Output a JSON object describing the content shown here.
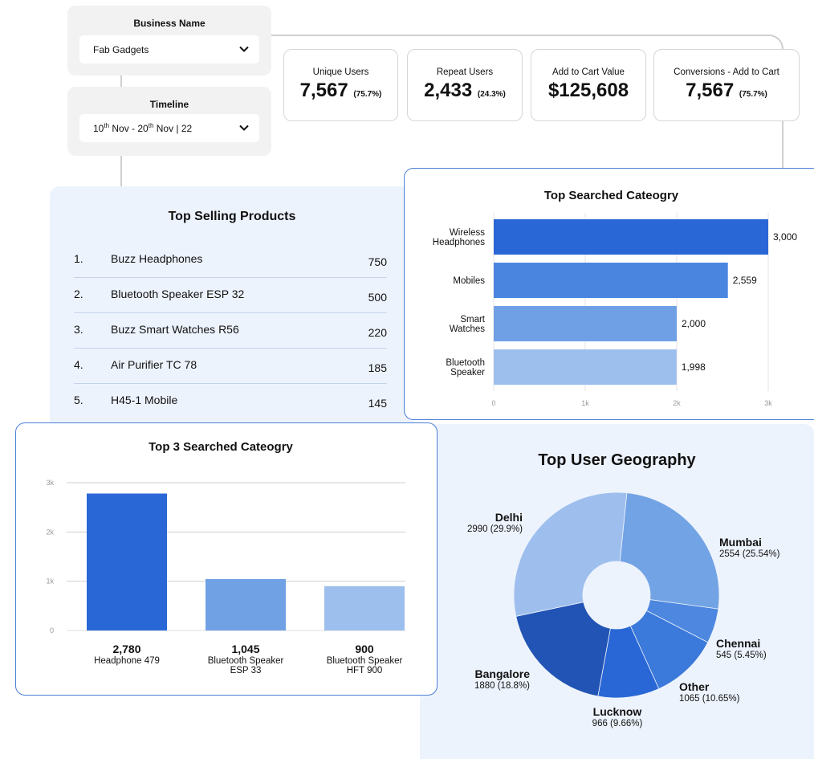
{
  "filters": {
    "business": {
      "title": "Business Name",
      "value": "Fab Gadgets"
    },
    "timeline": {
      "title": "Timeline",
      "value": "10th Nov - 20th Nov | 22"
    }
  },
  "stats": [
    {
      "label": "Unique Users",
      "value": "7,567",
      "pct": "(75.7%)"
    },
    {
      "label": "Repeat Users",
      "value": "2,433",
      "pct": "(24.3%)"
    },
    {
      "label": "Add to Cart Value",
      "value": "$125,608",
      "pct": ""
    },
    {
      "label": "Conversions - Add to Cart",
      "value": "7,567",
      "pct": "(75.7%)"
    }
  ],
  "top_selling": {
    "title": "Top Selling Products",
    "items": [
      {
        "rank": "1.",
        "name": "Buzz Headphones",
        "count": "750"
      },
      {
        "rank": "2.",
        "name": "Bluetooth Speaker ESP 32",
        "count": "500"
      },
      {
        "rank": "3.",
        "name": "Buzz Smart Watches R56",
        "count": "220"
      },
      {
        "rank": "4.",
        "name": "Air Purifier TC 78",
        "count": "185"
      },
      {
        "rank": "5.",
        "name": "H45-1 Mobile",
        "count": "145"
      }
    ]
  },
  "chart_data": [
    {
      "type": "bar",
      "orientation": "horizontal",
      "title": "Top Searched Cateogry",
      "categories": [
        [
          "Wireless",
          "Headphones"
        ],
        [
          "Mobiles"
        ],
        [
          "Smart",
          "Watches"
        ],
        [
          "Bluetooth",
          "Speaker"
        ]
      ],
      "values": [
        3000,
        2559,
        2000,
        1998
      ],
      "value_labels": [
        "3,000",
        "2,559",
        "2,000",
        "1,998"
      ],
      "colors": [
        "#2a67d6",
        "#4a86df",
        "#6fa0e6",
        "#9dbfee"
      ],
      "xlim": [
        0,
        3000
      ],
      "ticks": [
        "0",
        "1k",
        "2k",
        "3k"
      ]
    },
    {
      "type": "bar",
      "title": "Top 3 Searched Cateogry",
      "values": [
        2780,
        1045,
        900
      ],
      "value_labels": [
        "2,780",
        "1,045",
        "900"
      ],
      "categories": [
        [
          "Headphone 479"
        ],
        [
          "Bluetooth Speaker",
          "ESP 33"
        ],
        [
          "Bluetooth Speaker",
          "HFT 900"
        ]
      ],
      "colors": [
        "#2a67d6",
        "#70a1e5",
        "#9dbfee"
      ],
      "ylim": [
        0,
        3000
      ],
      "ticks": [
        "0",
        "1k",
        "2k",
        "3k"
      ]
    },
    {
      "type": "pie",
      "title": "Top User Geography",
      "slices": [
        {
          "name": "Mumbai",
          "value": 2554,
          "label": "2554 (25.54%)",
          "color": "#72a3e4"
        },
        {
          "name": "Chennai",
          "value": 545,
          "label": "545 (5.45%)",
          "color": "#4d87df"
        },
        {
          "name": "Other",
          "value": 1065,
          "label": "1065 (10.65%)",
          "color": "#3b79da"
        },
        {
          "name": "Lucknow",
          "value": 966,
          "label": "966 (9.66%)",
          "color": "#2a67d6"
        },
        {
          "name": "Bangalore",
          "value": 1880,
          "label": "1880 (18.8%)",
          "color": "#2254b5"
        },
        {
          "name": "Delhi",
          "value": 2990,
          "label": "2990 (29.9%)",
          "color": "#9ebfee"
        }
      ]
    }
  ]
}
